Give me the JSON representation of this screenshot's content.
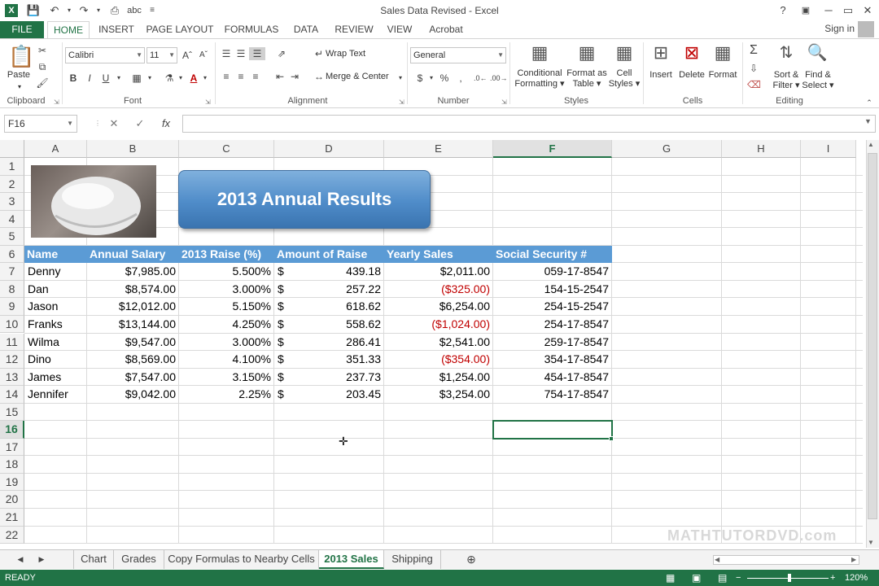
{
  "window": {
    "title": "Sales Data Revised - Excel",
    "help": "?",
    "minimize": "─",
    "restore": "▭",
    "close": "✕"
  },
  "quick_access": [
    "save-icon",
    "undo-icon",
    "redo-icon",
    "print-preview-icon",
    "spelling-icon"
  ],
  "ribbon_tabs": [
    "FILE",
    "HOME",
    "INSERT",
    "PAGE LAYOUT",
    "FORMULAS",
    "DATA",
    "REVIEW",
    "VIEW",
    "Acrobat"
  ],
  "active_tab": "HOME",
  "signin": "Sign in",
  "clipboard": {
    "paste": "Paste",
    "label": "Clipboard"
  },
  "font": {
    "name": "Calibri",
    "size": "11",
    "label": "Font",
    "bold": "B",
    "italic": "I",
    "underline": "U"
  },
  "alignment": {
    "wrap_text": "Wrap Text",
    "merge_center": "Merge & Center",
    "label": "Alignment"
  },
  "number": {
    "format": "General",
    "currency": "$",
    "percent": "%",
    "comma": ",",
    "label": "Number"
  },
  "styles": {
    "conditional": [
      "Conditional",
      "Formatting"
    ],
    "format_table": [
      "Format as",
      "Table"
    ],
    "cell_styles": [
      "Cell",
      "Styles"
    ],
    "label": "Styles"
  },
  "cells": {
    "insert": "Insert",
    "delete": "Delete",
    "format": "Format",
    "label": "Cells"
  },
  "editing": {
    "sort": [
      "Sort &",
      "Filter"
    ],
    "find": [
      "Find &",
      "Select"
    ],
    "label": "Editing"
  },
  "formula_bar": {
    "name_box": "F16",
    "cancel": "✕",
    "enter": "✓",
    "fx": "fx",
    "value": ""
  },
  "columns": [
    "A",
    "B",
    "C",
    "D",
    "E",
    "F",
    "G",
    "H",
    "I"
  ],
  "rows": [
    "1",
    "2",
    "3",
    "4",
    "5",
    "6",
    "7",
    "8",
    "9",
    "10",
    "11",
    "12",
    "13",
    "14",
    "15",
    "16",
    "17",
    "18",
    "19",
    "20",
    "21",
    "22"
  ],
  "selected_cell": "F16",
  "banner_title": "2013 Annual Results",
  "table": {
    "headers": [
      "Name",
      "Annual Salary",
      "2013 Raise (%)",
      "Amount of Raise",
      "Yearly Sales",
      "Social Security #"
    ],
    "rows": [
      {
        "name": "Denny",
        "salary": "$7,985.00",
        "raise_pct": "5.500%",
        "cur": "$",
        "raise_amt": "439.18",
        "sales": "$2,011.00",
        "ssn": "059-17-8547",
        "neg": false
      },
      {
        "name": "Dan",
        "salary": "$8,574.00",
        "raise_pct": "3.000%",
        "cur": "$",
        "raise_amt": "257.22",
        "sales": "($325.00)",
        "ssn": "154-15-2547",
        "neg": true
      },
      {
        "name": "Jason",
        "salary": "$12,012.00",
        "raise_pct": "5.150%",
        "cur": "$",
        "raise_amt": "618.62",
        "sales": "$6,254.00",
        "ssn": "254-15-2547",
        "neg": false
      },
      {
        "name": "Franks",
        "salary": "$13,144.00",
        "raise_pct": "4.250%",
        "cur": "$",
        "raise_amt": "558.62",
        "sales": "($1,024.00)",
        "ssn": "254-17-8547",
        "neg": true
      },
      {
        "name": "Wilma",
        "salary": "$9,547.00",
        "raise_pct": "3.000%",
        "cur": "$",
        "raise_amt": "286.41",
        "sales": "$2,541.00",
        "ssn": "259-17-8547",
        "neg": false
      },
      {
        "name": "Dino",
        "salary": "$8,569.00",
        "raise_pct": "4.100%",
        "cur": "$",
        "raise_amt": "351.33",
        "sales": "($354.00)",
        "ssn": "354-17-8547",
        "neg": true
      },
      {
        "name": "James",
        "salary": "$7,547.00",
        "raise_pct": "3.150%",
        "cur": "$",
        "raise_amt": "237.73",
        "sales": "$1,254.00",
        "ssn": "454-17-8547",
        "neg": false
      },
      {
        "name": "Jennifer",
        "salary": "$9,042.00",
        "raise_pct": "2.25%",
        "cur": "$",
        "raise_amt": "203.45",
        "sales": "$3,254.00",
        "ssn": "754-17-8547",
        "neg": false
      }
    ]
  },
  "sheet_tabs": [
    "Chart",
    "Grades",
    "Copy Formulas to Nearby Cells",
    "2013 Sales",
    "Shipping"
  ],
  "active_sheet": "2013 Sales",
  "status": {
    "mode": "READY",
    "zoom": "120%"
  },
  "watermark": "MATHTUTORDVD.com",
  "colors": {
    "excel_green": "#217346",
    "header_fill": "#5b9bd5",
    "negative": "#c00000"
  }
}
